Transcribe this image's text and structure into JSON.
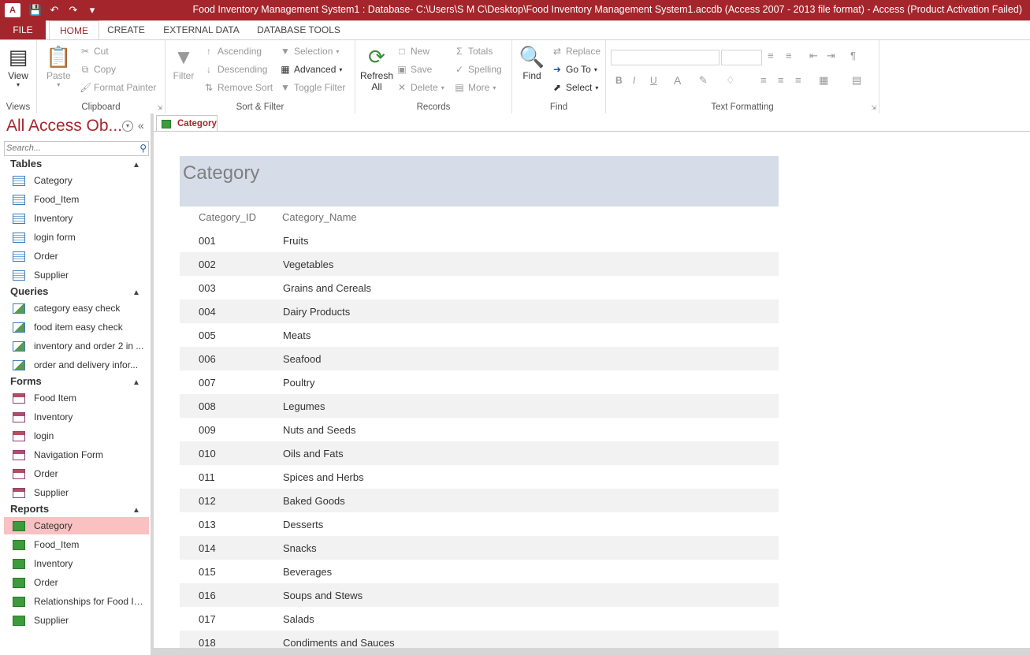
{
  "titlebar": {
    "title": "Food Inventory Management System1 : Database- C:\\Users\\S M C\\Desktop\\Food Inventory Management System1.accdb (Access 2007 - 2013 file format) -  Access (Product Activation Failed)",
    "logo_text": "A"
  },
  "ribbon_tabs": {
    "file": "FILE",
    "home": "HOME",
    "create": "CREATE",
    "external": "EXTERNAL DATA",
    "dbtools": "DATABASE TOOLS"
  },
  "ribbon": {
    "views": {
      "label": "Views",
      "view": "View"
    },
    "clipboard": {
      "label": "Clipboard",
      "paste": "Paste",
      "cut": "Cut",
      "copy": "Copy",
      "format_painter": "Format Painter"
    },
    "sort_filter": {
      "label": "Sort & Filter",
      "filter": "Filter",
      "ascending": "Ascending",
      "descending": "Descending",
      "remove_sort": "Remove Sort",
      "selection": "Selection",
      "advanced": "Advanced",
      "toggle_filter": "Toggle Filter"
    },
    "records": {
      "label": "Records",
      "refresh": "Refresh",
      "refresh_all": "All",
      "new": "New",
      "save": "Save",
      "delete": "Delete",
      "totals": "Totals",
      "spelling": "Spelling",
      "more": "More"
    },
    "find": {
      "label": "Find",
      "find": "Find",
      "replace": "Replace",
      "goto": "Go To",
      "select": "Select"
    },
    "text_formatting": {
      "label": "Text Formatting",
      "bold": "B",
      "italic": "I",
      "underline": "U",
      "font_color": "A"
    }
  },
  "nav": {
    "title": "All Access Ob...",
    "search_placeholder": "Search...",
    "sections": {
      "tables": {
        "label": "Tables",
        "items": [
          "Category",
          "Food_Item",
          "Inventory",
          "login form",
          "Order",
          "Supplier"
        ]
      },
      "queries": {
        "label": "Queries",
        "items": [
          "category easy check",
          "food item easy check",
          "inventory and order 2 in ...",
          "order and delivery  infor..."
        ]
      },
      "forms": {
        "label": "Forms",
        "items": [
          "Food Item",
          "Inventory",
          "login",
          "Navigation Form",
          "Order",
          "Supplier"
        ]
      },
      "reports": {
        "label": "Reports",
        "items": [
          "Category",
          "Food_Item",
          "Inventory",
          "Order",
          "Relationships for Food In...",
          "Supplier"
        ]
      }
    }
  },
  "document": {
    "tab_label": "Category",
    "report_title": "Category",
    "columns": [
      "Category_ID",
      "Category_Name"
    ],
    "rows": [
      [
        "001",
        "Fruits"
      ],
      [
        "002",
        "Vegetables"
      ],
      [
        "003",
        "Grains and Cereals"
      ],
      [
        "004",
        "Dairy Products"
      ],
      [
        "005",
        "Meats"
      ],
      [
        "006",
        "Seafood"
      ],
      [
        "007",
        "Poultry"
      ],
      [
        "008",
        "Legumes"
      ],
      [
        "009",
        "Nuts and Seeds"
      ],
      [
        "010",
        "Oils and Fats"
      ],
      [
        "011",
        "Spices and Herbs"
      ],
      [
        "012",
        "Baked Goods"
      ],
      [
        "013",
        "Desserts"
      ],
      [
        "014",
        "Snacks"
      ],
      [
        "015",
        "Beverages"
      ],
      [
        "016",
        "Soups and Stews"
      ],
      [
        "017",
        "Salads"
      ],
      [
        "018",
        "Condiments and Sauces"
      ]
    ]
  },
  "colors": {
    "accent": "#a4262c",
    "selection": "#f9c1c1",
    "report_header": "#d6dde8"
  }
}
